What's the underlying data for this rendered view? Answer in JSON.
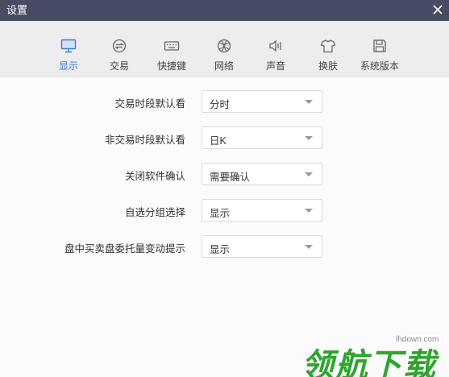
{
  "window": {
    "title": "设置"
  },
  "tabs": [
    {
      "label": "显示",
      "icon": "monitor-icon",
      "active": true
    },
    {
      "label": "交易",
      "icon": "exchange-icon"
    },
    {
      "label": "快捷键",
      "icon": "keyboard-icon"
    },
    {
      "label": "网络",
      "icon": "globe-icon"
    },
    {
      "label": "声音",
      "icon": "speaker-icon"
    },
    {
      "label": "换肤",
      "icon": "shirt-icon"
    },
    {
      "label": "系统版本",
      "icon": "floppy-icon"
    }
  ],
  "settings": [
    {
      "label": "交易时段默认看",
      "value": "分时"
    },
    {
      "label": "非交易时段默认看",
      "value": "日K"
    },
    {
      "label": "关闭软件确认",
      "value": "需要确认"
    },
    {
      "label": "自选分组选择",
      "value": "显示"
    },
    {
      "label": "盘中买卖盘委托量变动提示",
      "value": "显示"
    }
  ],
  "watermark": {
    "text": "领航下载",
    "url": "lhdown.com"
  },
  "colors": {
    "titlebar": "#474b63",
    "accent": "#3a7bd5",
    "watermark": "#2fa52f"
  }
}
